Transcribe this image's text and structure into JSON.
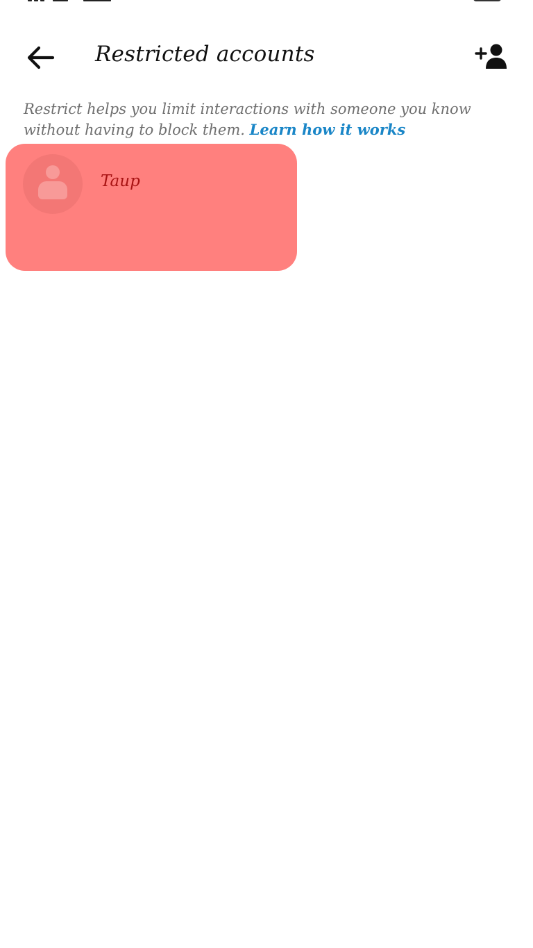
{
  "header": {
    "title": "Restricted accounts",
    "back_icon": "arrow-left-icon",
    "add_icon": "add-person-icon"
  },
  "description": {
    "text": "Restrict helps you limit interactions with someone you know without having to block them.",
    "link_label": "Learn how it works"
  },
  "restricted_accounts": [
    {
      "name": "Taup"
    }
  ],
  "colors": {
    "background": "#ffffff",
    "text_primary": "#111111",
    "text_secondary": "#6f6f6f",
    "link": "#1a86c7",
    "highlight": "#ff807e"
  }
}
